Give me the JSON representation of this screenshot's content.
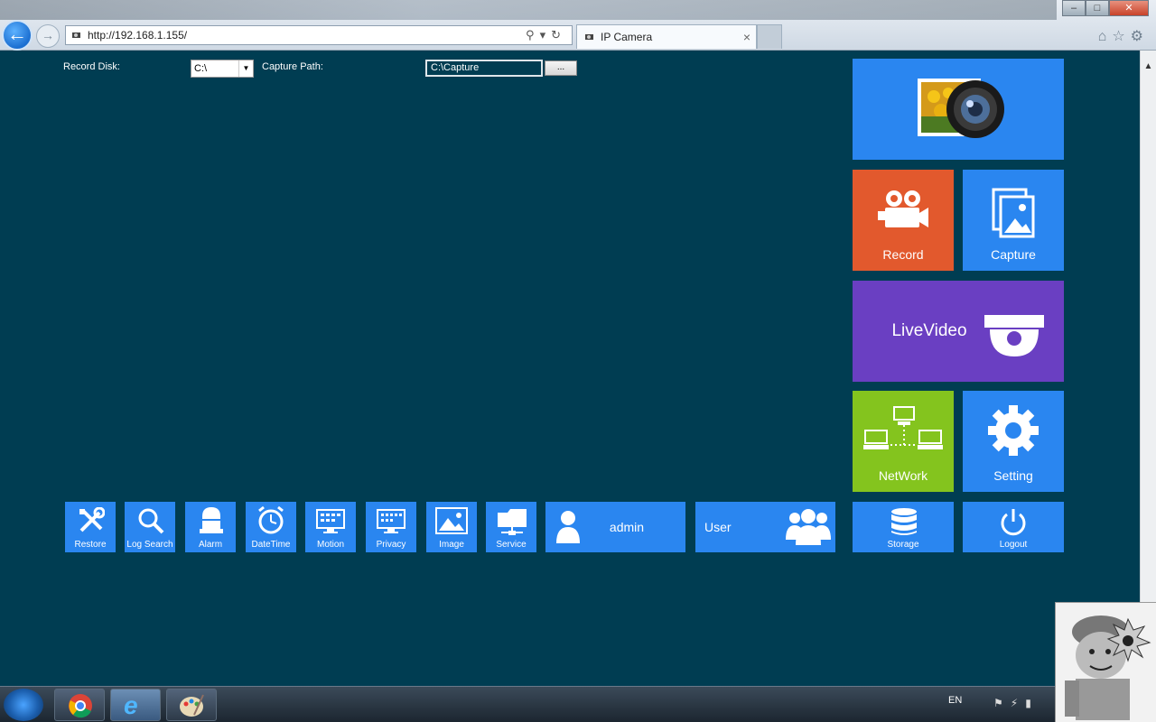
{
  "browser": {
    "url": "http://192.168.1.155/",
    "tab_title": "IP Camera",
    "tab_close": "×"
  },
  "form": {
    "record_disk_label": "Record Disk:",
    "record_disk_value": "C:\\",
    "capture_path_label": "Capture Path:",
    "capture_path_value": "C:\\Capture",
    "browse_label": "..."
  },
  "tiles": {
    "record": "Record",
    "capture": "Capture",
    "livevideo": "LiveVideo",
    "network": "NetWork",
    "setting": "Setting",
    "storage": "Storage",
    "logout": "Logout",
    "admin": "admin",
    "user": "User"
  },
  "toolbar": [
    {
      "label": "Restore",
      "icon": "tools-icon"
    },
    {
      "label": "Log Search",
      "icon": "magnifier-icon"
    },
    {
      "label": "Alarm",
      "icon": "alarm-light-icon"
    },
    {
      "label": "DateTime",
      "icon": "clock-icon"
    },
    {
      "label": "Motion",
      "icon": "monitor-grid-icon"
    },
    {
      "label": "Privacy",
      "icon": "monitor-dots-icon"
    },
    {
      "label": "Image",
      "icon": "picture-icon"
    },
    {
      "label": "Service",
      "icon": "folder-network-icon"
    }
  ],
  "taskbar": {
    "language": "EN"
  },
  "colors": {
    "background": "#003d52",
    "tile_blue": "#2a86f0",
    "tile_orange": "#e2592d",
    "tile_purple": "#6a3fc2",
    "tile_green": "#84c41e"
  }
}
